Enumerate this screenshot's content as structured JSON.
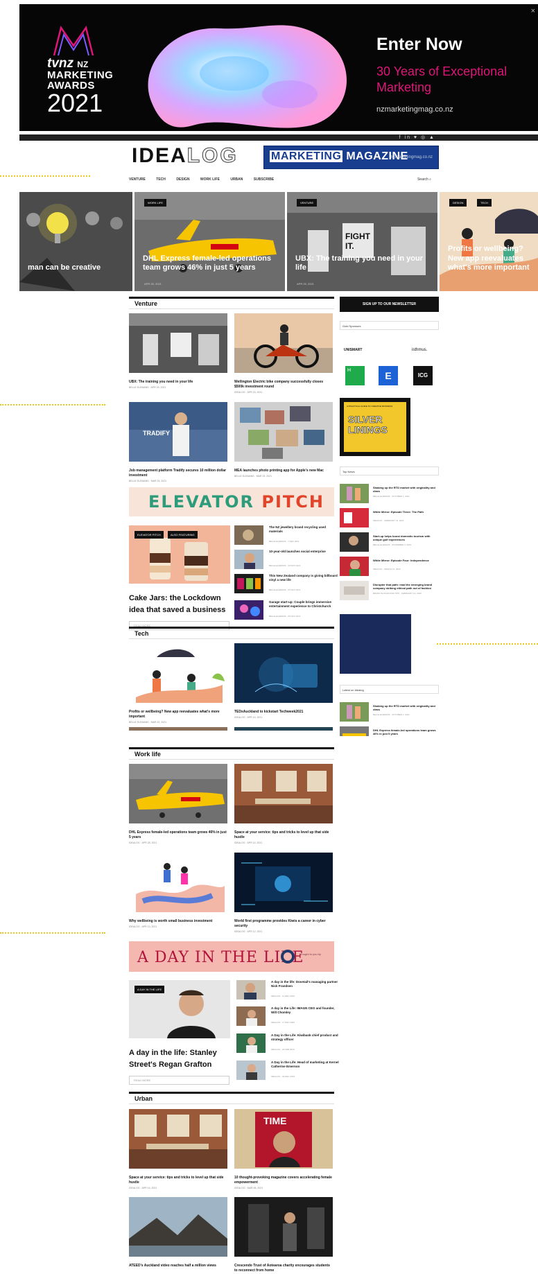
{
  "banner": {
    "logo_line1": "tvnz",
    "logo_line1_suffix": "NZ",
    "logo_line2": "MARKETING",
    "logo_line3": "AWARDS",
    "logo_year": "2021",
    "headline": "Enter Now",
    "subline": "30 Years of Exceptional Marketing",
    "site": "nzmarketingmag.co.nz",
    "close": "×"
  },
  "strip": {
    "social": "f in ♥ ◎ ▲"
  },
  "header": {
    "logo_idea": "IDEA",
    "logo_log": "LOG",
    "ad_title_a": "MARKETING",
    "ad_title_b": "MAGAZINE",
    "ad_url": "nzmarketingmag.co.nz"
  },
  "nav": {
    "items": [
      "VENTURE",
      "TECH",
      "DESIGN",
      "WORK LIFE",
      "URBAN",
      "SUBSCRIBE"
    ],
    "search": "Search ⌕"
  },
  "hero": [
    {
      "caption": "man can be creative",
      "tags": [],
      "meta": ""
    },
    {
      "caption": "DHL Express female-led operations team grows 46% in just 5 years",
      "tags": [
        "WORK LIFE"
      ],
      "meta": "APR 28, 2021"
    },
    {
      "caption": "UBX: The training you need in your life",
      "tags": [
        "VENTURE"
      ],
      "meta": "APR 29, 2021"
    },
    {
      "caption": "Profits or wellbeing? New app reevaluates what's more important",
      "tags": [
        "DESIGN",
        "TECH"
      ],
      "meta": ""
    }
  ],
  "sections": {
    "venture": "Venture",
    "tech": "Tech",
    "worklife": "Work life",
    "urban": "Urban"
  },
  "venture_cards": [
    {
      "title": "UBX: The training you need in your life",
      "meta": "BELLE ELEMANS · APR 29, 2021"
    },
    {
      "title": "Wellington Electric bike company successfully closes $500k investment round",
      "meta": "IDEALOG · APR 23, 2021"
    },
    {
      "title": "Job management platform Tradify secures 10 million dollar investment",
      "meta": "BELLE ELEMANS · MAR 23, 2021"
    },
    {
      "title": "MEA launches photo printing app for Apple's new Mac",
      "meta": "BELLE ELEMANS · MAR 23, 2021"
    }
  ],
  "elevator": {
    "a": "ELEVATOR",
    "b": "PITCH"
  },
  "elevator_feature": {
    "tags": [
      "ELEVATOR PITCH",
      "ALSO FEATURING"
    ],
    "title": "Cake Jars: the Lockdown idea that saved a business",
    "button": "READ MORE"
  },
  "elevator_list": [
    {
      "title": "The NZ jewellery brand recycling used materials",
      "meta": "BELLE ELEMANS · 7 DEC 2021"
    },
    {
      "title": "10-year-old launches social enterprise",
      "meta": "BELLE ELEMANS · 30 NOV 2021"
    },
    {
      "title": "This New Zealand company is giving billboard vinyl a new life",
      "meta": "BELLE ELEMANS · 25 NOV 2021"
    },
    {
      "title": "Garage start-up: Couple brings immersive entertainment experience to Christchurch",
      "meta": "BELLE ELEMANS · 25 NOV 2021"
    }
  ],
  "tech_cards": [
    {
      "title": "Profits or wellbeing? New app reevaluates what's more important",
      "meta": "BELLE ELEMANS · MAR 22, 2021"
    },
    {
      "title": "TEDxAuckland to kickstart Techweek2021",
      "meta": "IDEALOG · APR 19, 2021"
    }
  ],
  "worklife_cards": [
    {
      "title": "DHL Express female-led operations team grows 46% in just 5 years",
      "meta": "IDEALOG · APR 28, 2021"
    },
    {
      "title": "Space at your service: tips and tricks to level up that side hustle",
      "meta": "IDEALOG · APR 14, 2021"
    },
    {
      "title": "Why wellbeing is worth small business investment",
      "meta": "IDEALOG · APR 13, 2021"
    },
    {
      "title": "World first programme provides Kiwis a career in cyber security",
      "meta": "IDEALOG · APR 12, 2021"
    }
  ],
  "daylife": {
    "title": "A DAY IN THE LIFE",
    "sponsor": "brought to you by"
  },
  "daylife_feature": {
    "tag": "A DAY IN THE LIFE",
    "title": "A day in the life: Stanley Street's Regan Grafton",
    "button": "READ MORE"
  },
  "daylife_list": [
    {
      "title": "A day in the life: Dovetail's managing partner Nick Frandsen",
      "meta": "IDEALOG · 11 DEC 2020"
    },
    {
      "title": "A day in the Life: IMAGN CEO and founder, Will Chomley",
      "meta": "IDEALOG · 17 DEC 2020"
    },
    {
      "title": "A Day in the Life: Kiwibank chief product and strategy officer",
      "meta": "IDEALOG · 24 FEB 2020"
    },
    {
      "title": "A Day in the Life: Head of marketing at Kernel Catherine Emerson",
      "meta": "IDEALOG · 03 DEC 2019"
    }
  ],
  "urban_cards": [
    {
      "title": "Space at your service: tips and tricks to level up that side hustle",
      "meta": "IDEALOG · APR 14, 2021"
    },
    {
      "title": "10 thought-provoking magazine covers accelerating female empowerment",
      "meta": "IDEALOG · MAR 08, 2021"
    },
    {
      "title": "ATEED's Auckland video reaches half a million views",
      "meta": ""
    },
    {
      "title": "Crescendo Trust of Aotearoa charity encourages students to reconnect from home",
      "meta": ""
    }
  ],
  "sidebar": {
    "newsletter": "SIGN UP TO OUR NEWSLETTER",
    "gold_sponsors": "Gold Sponsors",
    "sponsor_names": [
      "UNISMART",
      "isthmus."
    ],
    "sponsor_icons": [
      "H",
      "E",
      "ICG"
    ],
    "silver_title": "SILVER LININGS",
    "silver_top": "A PRACTICAL GUIDE TO CREATIVE BUSINESS",
    "top_news": "Top News",
    "top_items": [
      {
        "title": "Shaking up the RTD market with originality and class",
        "meta": "BELLE ELEMANS · OCTOBER 1, 2021"
      },
      {
        "title": "White Mirror: Episode Three: The Path",
        "meta": "IDEALOG · FEBRUARY 11, 2021"
      },
      {
        "title": "Start-up helps boost domestic tourism with unique golf experiences",
        "meta": "BELLE ELEMANS · NOVEMBER 3, 2021"
      },
      {
        "title": "White Mirror: Episode Four: Independence",
        "meta": "IDEALOG · MARCH 12, 2020"
      },
      {
        "title": "Disrupter that path: read the emerging brand company striking ethical path out of fashion",
        "meta": "BRAND SLOGAN AND TIPS · FEBRUARY 13, 2020"
      }
    ],
    "latest": "Latest on Idealog",
    "latest_items": [
      {
        "title": "Shaking up the RTD market with originality and class",
        "meta": "BELLE ELEMANS · OCTOBER 1, 2021"
      },
      {
        "title": "DHL Express female-led operations team grows 46% in just 5 years",
        "meta": ""
      }
    ]
  }
}
